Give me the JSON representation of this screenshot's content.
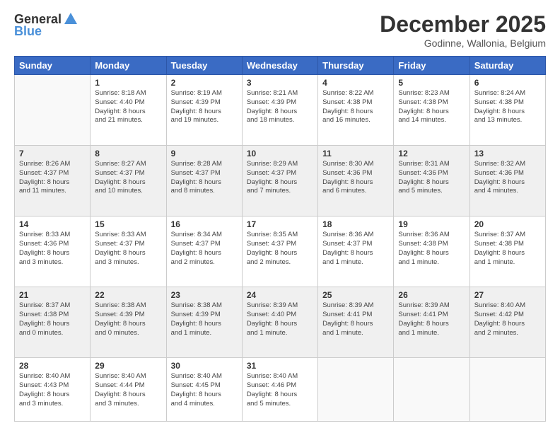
{
  "header": {
    "logo_general": "General",
    "logo_blue": "Blue",
    "month_title": "December 2025",
    "location": "Godinne, Wallonia, Belgium"
  },
  "weekdays": [
    "Sunday",
    "Monday",
    "Tuesday",
    "Wednesday",
    "Thursday",
    "Friday",
    "Saturday"
  ],
  "weeks": [
    [
      {
        "day": "",
        "info": ""
      },
      {
        "day": "1",
        "info": "Sunrise: 8:18 AM\nSunset: 4:40 PM\nDaylight: 8 hours\nand 21 minutes."
      },
      {
        "day": "2",
        "info": "Sunrise: 8:19 AM\nSunset: 4:39 PM\nDaylight: 8 hours\nand 19 minutes."
      },
      {
        "day": "3",
        "info": "Sunrise: 8:21 AM\nSunset: 4:39 PM\nDaylight: 8 hours\nand 18 minutes."
      },
      {
        "day": "4",
        "info": "Sunrise: 8:22 AM\nSunset: 4:38 PM\nDaylight: 8 hours\nand 16 minutes."
      },
      {
        "day": "5",
        "info": "Sunrise: 8:23 AM\nSunset: 4:38 PM\nDaylight: 8 hours\nand 14 minutes."
      },
      {
        "day": "6",
        "info": "Sunrise: 8:24 AM\nSunset: 4:38 PM\nDaylight: 8 hours\nand 13 minutes."
      }
    ],
    [
      {
        "day": "7",
        "info": "Sunrise: 8:26 AM\nSunset: 4:37 PM\nDaylight: 8 hours\nand 11 minutes."
      },
      {
        "day": "8",
        "info": "Sunrise: 8:27 AM\nSunset: 4:37 PM\nDaylight: 8 hours\nand 10 minutes."
      },
      {
        "day": "9",
        "info": "Sunrise: 8:28 AM\nSunset: 4:37 PM\nDaylight: 8 hours\nand 8 minutes."
      },
      {
        "day": "10",
        "info": "Sunrise: 8:29 AM\nSunset: 4:37 PM\nDaylight: 8 hours\nand 7 minutes."
      },
      {
        "day": "11",
        "info": "Sunrise: 8:30 AM\nSunset: 4:36 PM\nDaylight: 8 hours\nand 6 minutes."
      },
      {
        "day": "12",
        "info": "Sunrise: 8:31 AM\nSunset: 4:36 PM\nDaylight: 8 hours\nand 5 minutes."
      },
      {
        "day": "13",
        "info": "Sunrise: 8:32 AM\nSunset: 4:36 PM\nDaylight: 8 hours\nand 4 minutes."
      }
    ],
    [
      {
        "day": "14",
        "info": "Sunrise: 8:33 AM\nSunset: 4:36 PM\nDaylight: 8 hours\nand 3 minutes."
      },
      {
        "day": "15",
        "info": "Sunrise: 8:33 AM\nSunset: 4:37 PM\nDaylight: 8 hours\nand 3 minutes."
      },
      {
        "day": "16",
        "info": "Sunrise: 8:34 AM\nSunset: 4:37 PM\nDaylight: 8 hours\nand 2 minutes."
      },
      {
        "day": "17",
        "info": "Sunrise: 8:35 AM\nSunset: 4:37 PM\nDaylight: 8 hours\nand 2 minutes."
      },
      {
        "day": "18",
        "info": "Sunrise: 8:36 AM\nSunset: 4:37 PM\nDaylight: 8 hours\nand 1 minute."
      },
      {
        "day": "19",
        "info": "Sunrise: 8:36 AM\nSunset: 4:38 PM\nDaylight: 8 hours\nand 1 minute."
      },
      {
        "day": "20",
        "info": "Sunrise: 8:37 AM\nSunset: 4:38 PM\nDaylight: 8 hours\nand 1 minute."
      }
    ],
    [
      {
        "day": "21",
        "info": "Sunrise: 8:37 AM\nSunset: 4:38 PM\nDaylight: 8 hours\nand 0 minutes."
      },
      {
        "day": "22",
        "info": "Sunrise: 8:38 AM\nSunset: 4:39 PM\nDaylight: 8 hours\nand 0 minutes."
      },
      {
        "day": "23",
        "info": "Sunrise: 8:38 AM\nSunset: 4:39 PM\nDaylight: 8 hours\nand 1 minute."
      },
      {
        "day": "24",
        "info": "Sunrise: 8:39 AM\nSunset: 4:40 PM\nDaylight: 8 hours\nand 1 minute."
      },
      {
        "day": "25",
        "info": "Sunrise: 8:39 AM\nSunset: 4:41 PM\nDaylight: 8 hours\nand 1 minute."
      },
      {
        "day": "26",
        "info": "Sunrise: 8:39 AM\nSunset: 4:41 PM\nDaylight: 8 hours\nand 1 minute."
      },
      {
        "day": "27",
        "info": "Sunrise: 8:40 AM\nSunset: 4:42 PM\nDaylight: 8 hours\nand 2 minutes."
      }
    ],
    [
      {
        "day": "28",
        "info": "Sunrise: 8:40 AM\nSunset: 4:43 PM\nDaylight: 8 hours\nand 3 minutes."
      },
      {
        "day": "29",
        "info": "Sunrise: 8:40 AM\nSunset: 4:44 PM\nDaylight: 8 hours\nand 3 minutes."
      },
      {
        "day": "30",
        "info": "Sunrise: 8:40 AM\nSunset: 4:45 PM\nDaylight: 8 hours\nand 4 minutes."
      },
      {
        "day": "31",
        "info": "Sunrise: 8:40 AM\nSunset: 4:46 PM\nDaylight: 8 hours\nand 5 minutes."
      },
      {
        "day": "",
        "info": ""
      },
      {
        "day": "",
        "info": ""
      },
      {
        "day": "",
        "info": ""
      }
    ]
  ]
}
